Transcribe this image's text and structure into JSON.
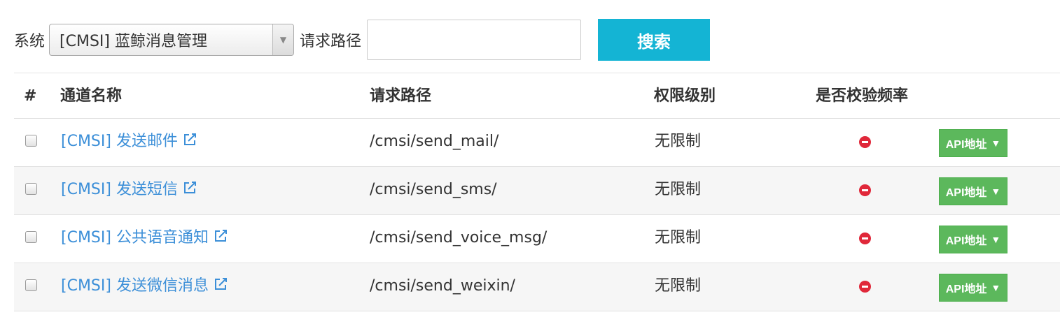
{
  "filter": {
    "system_label": "系统",
    "system_selected": "[CMSI] 蓝鲸消息管理",
    "path_label": "请求路径",
    "path_value": "",
    "search_label": "搜索"
  },
  "table": {
    "headers": {
      "index": "#",
      "name": "通道名称",
      "path": "请求路径",
      "permission": "权限级别",
      "rate_check": "是否校验频率"
    },
    "rows": [
      {
        "name": "[CMSI] 发送邮件",
        "path": "/cmsi/send_mail/",
        "permission": "无限制",
        "rate_check": false,
        "action": "API地址"
      },
      {
        "name": "[CMSI] 发送短信",
        "path": "/cmsi/send_sms/",
        "permission": "无限制",
        "rate_check": false,
        "action": "API地址"
      },
      {
        "name": "[CMSI] 公共语音通知",
        "path": "/cmsi/send_voice_msg/",
        "permission": "无限制",
        "rate_check": false,
        "action": "API地址"
      },
      {
        "name": "[CMSI] 发送微信消息",
        "path": "/cmsi/send_weixin/",
        "permission": "无限制",
        "rate_check": false,
        "action": "API地址"
      }
    ]
  },
  "colors": {
    "link": "#3c8fd8",
    "search_button": "#14b4d4",
    "api_button": "#5cb85c",
    "status_no": "#e0283a"
  }
}
